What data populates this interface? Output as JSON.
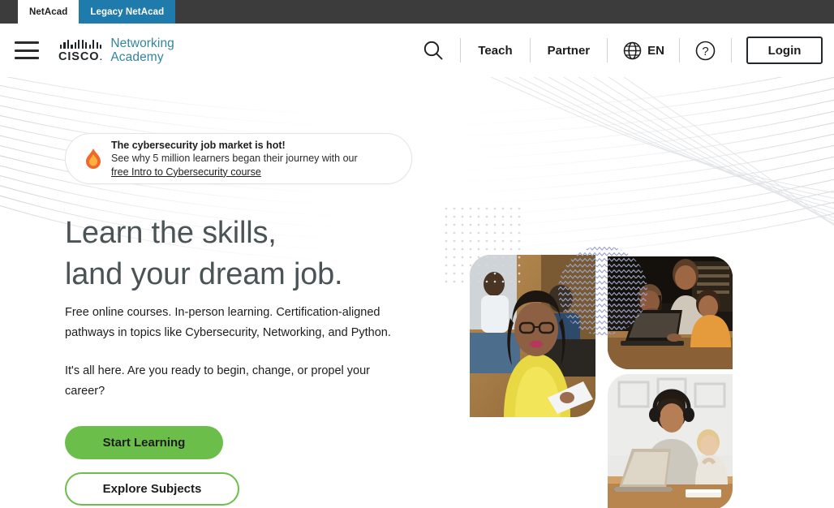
{
  "browser": {
    "tabs": [
      {
        "label": "NetAcad",
        "active": false
      },
      {
        "label": "Legacy NetAcad",
        "active": true
      }
    ]
  },
  "header": {
    "menu_icon": "hamburger-menu-icon",
    "logo": {
      "brand": "CISCO",
      "brand_dot": ".",
      "line1": "Networking",
      "line2": "Academy"
    },
    "search_icon": "search-icon",
    "nav": [
      {
        "label": "Teach"
      },
      {
        "label": "Partner"
      }
    ],
    "language": {
      "icon": "globe-icon",
      "label": "EN"
    },
    "help_icon": "question-mark-icon",
    "login_label": "Login"
  },
  "hero": {
    "promo": {
      "icon": "flame-icon",
      "title": "The cybersecurity job market is hot!",
      "subtitle": "See why 5 million learners began their journey with our",
      "link": "free Intro to Cybersecurity course"
    },
    "headline_line1": "Learn the skills,",
    "headline_line2": "land your dream job.",
    "paragraph1": "Free online courses. In-person learning. Certification-aligned pathways in topics like Cybersecurity, Networking, and Python.",
    "paragraph2": "It's all here. Are you ready to begin, change, or propel your career?",
    "cta_primary": "Start Learning",
    "cta_secondary": "Explore Subjects",
    "images": [
      {
        "name": "photo-woman-yellow-shirt-office"
      },
      {
        "name": "photo-three-students-laptop"
      },
      {
        "name": "photo-man-headphones-child-laptop"
      }
    ],
    "decorations": [
      {
        "name": "dot-grid-pattern"
      },
      {
        "name": "wavy-circle-pattern"
      },
      {
        "name": "flowing-lines-background"
      }
    ]
  },
  "colors": {
    "tab_active": "#1f7bab",
    "tab_bar": "#3c3c3c",
    "brand_teal": "#31859c",
    "cta_green": "#6cbe4b",
    "flame_orange": "#f0692a",
    "headline_gray": "#4a5457"
  }
}
